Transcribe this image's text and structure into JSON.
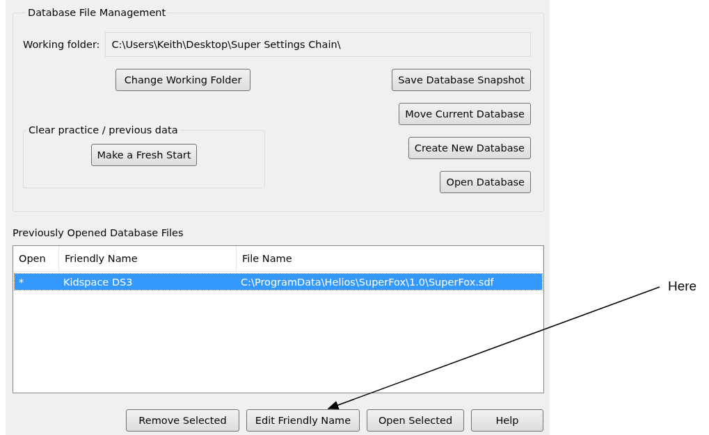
{
  "database_file_management": {
    "title": "Database File Management",
    "working_folder": {
      "label": "Working folder:",
      "value": "C:\\Users\\Keith\\Desktop\\Super Settings Chain\\"
    },
    "change_button": "Change Working Folder",
    "clear_group": {
      "title": "Clear practice / previous data",
      "button": "Make a Fresh Start"
    },
    "buttons": [
      "Save Database Snapshot",
      "Move Current Database",
      "Create New Database",
      "Open Database"
    ]
  },
  "previous_files": {
    "title": "Previously Opened Database Files",
    "columns": [
      "Open",
      "Friendly Name",
      "File Name"
    ],
    "rows": [
      {
        "open": "*",
        "friendly_name": "Kidspace DS3",
        "file_name": "C:\\ProgramData\\Helios\\SuperFox\\1.0\\SuperFox.sdf",
        "selected": true
      }
    ]
  },
  "bottom_buttons": [
    "Remove Selected",
    "Edit Friendly Name",
    "Open Selected",
    "Help"
  ],
  "annotation": {
    "text": "Here"
  }
}
